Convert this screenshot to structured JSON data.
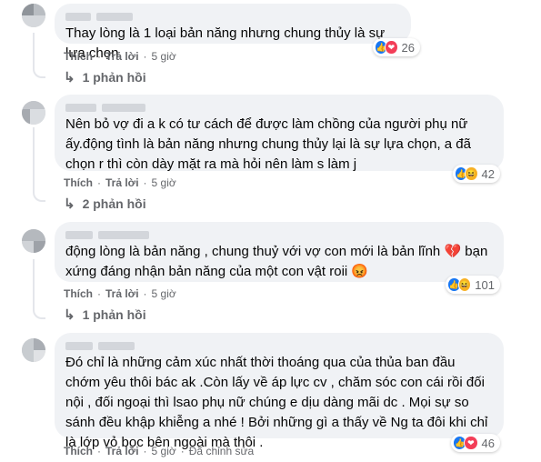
{
  "comments": [
    {
      "text": "Thay lòng là 1 loại bản năng nhưng chung thủy là sự lựa chọn",
      "reaction_count": "26",
      "reactions": [
        "like-icon",
        "love-icon"
      ],
      "like_label": "Thích",
      "reply_label": "Trả lời",
      "time": "5 giờ",
      "replies_label": "1 phản hồi"
    },
    {
      "text": "Nên bỏ vợ đi a k có tư cách để được làm chồng của người phụ nữ ấy.động tình là bản năng nhưng chung thủy lại là sự lựa chọn, a đã chọn r thì còn dày mặt ra mà hỏi nên làm s làm j",
      "reaction_count": "42",
      "reactions": [
        "like-icon",
        "haha-icon"
      ],
      "like_label": "Thích",
      "reply_label": "Trả lời",
      "time": "5 giờ",
      "replies_label": "2 phản hồi"
    },
    {
      "text": "động lòng là bản năng , chung thuỷ với vợ con mới là bản lĩnh 💔 bạn xứng đáng nhận bản năng của một con vật roii 😡",
      "reaction_count": "101",
      "reactions": [
        "like-icon",
        "haha-icon"
      ],
      "like_label": "Thích",
      "reply_label": "Trả lời",
      "time": "5 giờ",
      "replies_label": "1 phản hồi"
    },
    {
      "text": "Đó chỉ là những cảm xúc nhất thời thoáng qua của thủa ban đầu chớm yêu thôi bác ak .Còn lấy về áp lực cv , chăm sóc con cái rồi đối nội , đối ngoại thì lsao phụ nữ chúng e dịu dàng mãi dc . Mọi sự so sánh đều khập khiễng a nhé ! Bởi những gì a thấy về Ng ta đôi khi chỉ là lớp vỏ bọc bên ngoài mà thôi .",
      "reaction_count": "46",
      "reactions": [
        "like-icon",
        "love-icon"
      ],
      "like_label": "Thích",
      "reply_label": "Trả lời",
      "time": "5 giờ",
      "edited_label": "Đã chỉnh sửa"
    }
  ],
  "colors": {
    "bubble": "#f0f2f5",
    "meta_text": "#65676b",
    "like": "#1877f2",
    "love": "#f33e58",
    "haha": "#f7b125"
  }
}
